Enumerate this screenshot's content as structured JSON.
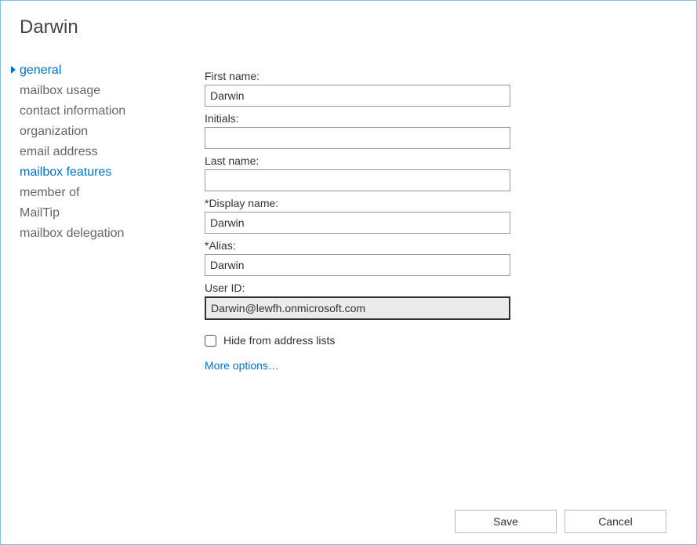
{
  "header": {
    "title": "Darwin"
  },
  "sidebar": {
    "items": [
      {
        "label": "general",
        "active": true
      },
      {
        "label": "mailbox usage"
      },
      {
        "label": "contact information"
      },
      {
        "label": "organization"
      },
      {
        "label": "email address"
      },
      {
        "label": "mailbox features",
        "link": true
      },
      {
        "label": "member of"
      },
      {
        "label": "MailTip"
      },
      {
        "label": "mailbox delegation"
      }
    ]
  },
  "form": {
    "first_name": {
      "label": "First name:",
      "value": "Darwin"
    },
    "initials": {
      "label": "Initials:",
      "value": ""
    },
    "last_name": {
      "label": "Last name:",
      "value": ""
    },
    "display_name": {
      "label": "*Display name:",
      "value": "Darwin"
    },
    "alias": {
      "label": "*Alias:",
      "value": "Darwin"
    },
    "user_id": {
      "label": "User ID:",
      "value": "Darwin@lewfh.onmicrosoft.com"
    },
    "hide_from_lists": {
      "label": "Hide from address lists",
      "checked": false
    },
    "more_options": "More options…"
  },
  "footer": {
    "save": "Save",
    "cancel": "Cancel"
  }
}
